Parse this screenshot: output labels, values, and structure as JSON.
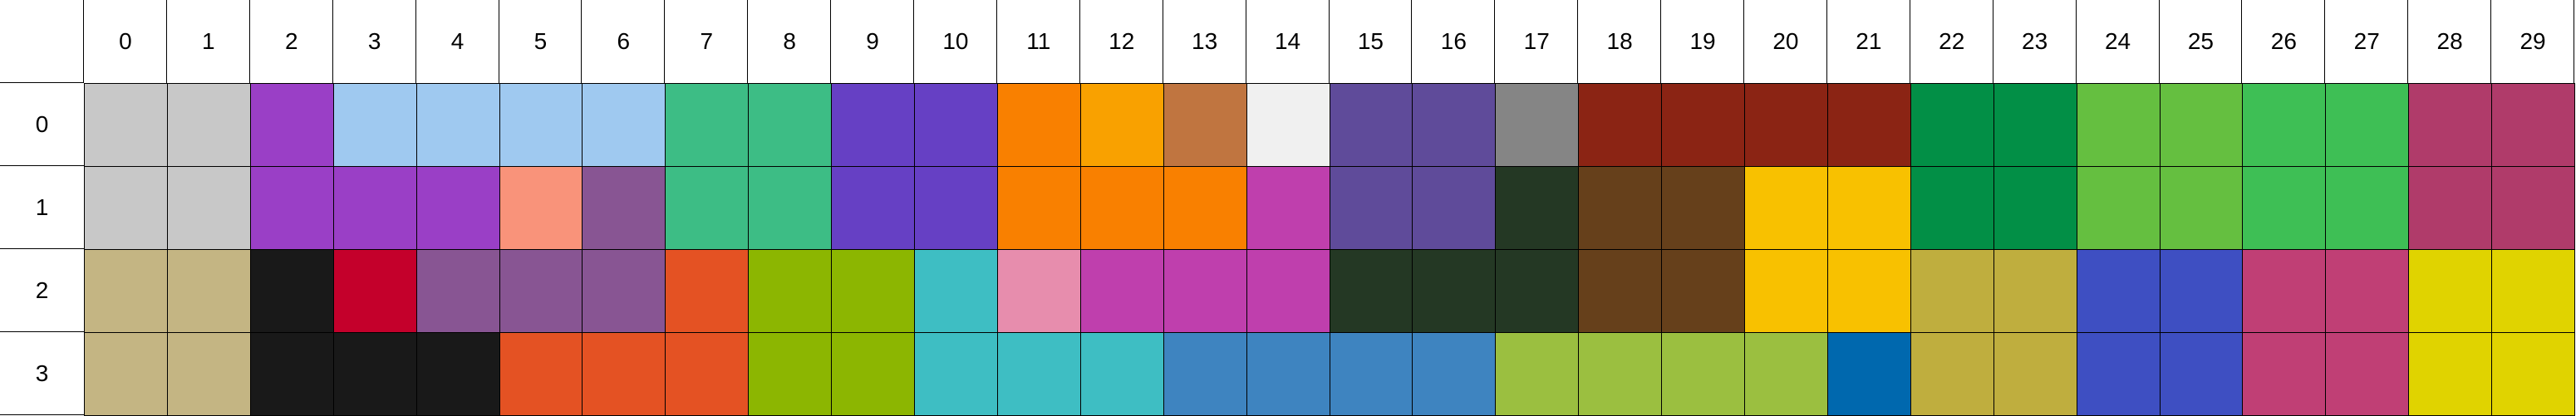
{
  "column_labels": [
    "0",
    "1",
    "2",
    "3",
    "4",
    "5",
    "6",
    "7",
    "8",
    "9",
    "10",
    "11",
    "12",
    "13",
    "14",
    "15",
    "16",
    "17",
    "18",
    "19",
    "20",
    "21",
    "22",
    "23",
    "24",
    "25",
    "26",
    "27",
    "28",
    "29"
  ],
  "row_labels": [
    "0",
    "1",
    "2",
    "3"
  ],
  "cell_colors": [
    [
      "#c8c8c8",
      "#c8c8c8",
      "#9a3fc6",
      "#9fc9f0",
      "#9fc9f0",
      "#9fc9f0",
      "#9fc9f0",
      "#3dbd85",
      "#3dbd85",
      "#6640c4",
      "#6640c4",
      "#f98000",
      "#f9a100",
      "#c07540",
      "#f0f0f0",
      "#5f4b9a",
      "#5f4b9a",
      "#858585",
      "#8b2414",
      "#8b2414",
      "#8b2414",
      "#8b2414",
      "#028f46",
      "#028f46",
      "#65bf40",
      "#65bf40",
      "#3ebf55",
      "#3ebf55",
      "#b03b6a",
      "#b03b6a"
    ],
    [
      "#c8c8c8",
      "#c8c8c8",
      "#9a3fc6",
      "#9a3fc6",
      "#9a3fc6",
      "#f9937a",
      "#885593",
      "#3dbd85",
      "#3dbd85",
      "#6640c4",
      "#6640c4",
      "#f98000",
      "#f98000",
      "#f98000",
      "#bf3fad",
      "#5f4b9a",
      "#5f4b9a",
      "#243824",
      "#66401b",
      "#66401b",
      "#f8c100",
      "#f8c100",
      "#028f46",
      "#028f46",
      "#65bf40",
      "#65bf40",
      "#3ebf55",
      "#3ebf55",
      "#b03b6a",
      "#b03b6a"
    ],
    [
      "#c4b583",
      "#c4b583",
      "#191919",
      "#c4002b",
      "#885593",
      "#885593",
      "#885593",
      "#e45223",
      "#8cb601",
      "#8cb601",
      "#3ebec3",
      "#e78dad",
      "#bf3fad",
      "#bf3fad",
      "#bf3fad",
      "#243824",
      "#243824",
      "#243824",
      "#66401b",
      "#66401b",
      "#f8c100",
      "#f8c100",
      "#bfae3e",
      "#bfae3e",
      "#3e4fc2",
      "#3e4fc2",
      "#c03f75",
      "#c03f75",
      "#e0d300",
      "#e0d300"
    ],
    [
      "#c4b583",
      "#c4b583",
      "#191919",
      "#191919",
      "#191919",
      "#e45223",
      "#e45223",
      "#e45223",
      "#8cb601",
      "#8cb601",
      "#3ebec3",
      "#3ebec3",
      "#3ebec3",
      "#3e84c0",
      "#3e84c0",
      "#3e84c0",
      "#3e84c0",
      "#9bbf40",
      "#9bbf40",
      "#9bbf40",
      "#9bbf40",
      "#0068ae",
      "#bfae3e",
      "#bfae3e",
      "#3e4fc2",
      "#3e4fc2",
      "#c03f75",
      "#c03f75",
      "#e0d300",
      "#e0d300"
    ]
  ]
}
